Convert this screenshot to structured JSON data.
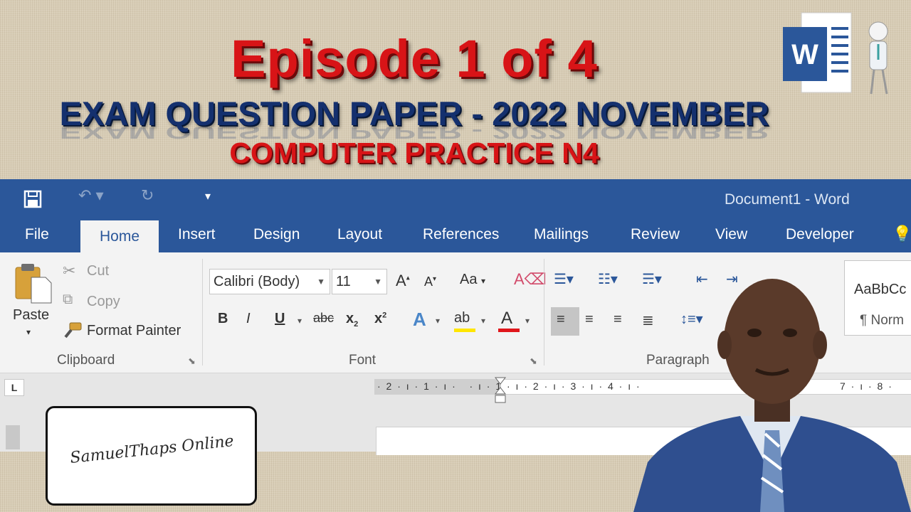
{
  "banner": {
    "episode": "Episode 1 of 4",
    "exam": "EXAM QUESTION PAPER - 2022 NOVEMBER",
    "course": "COMPUTER PRACTICE N4",
    "logo_letter": "W"
  },
  "window": {
    "title": "Document1 - Word",
    "tabs": [
      "File",
      "Home",
      "Insert",
      "Design",
      "Layout",
      "References",
      "Mailings",
      "Review",
      "View",
      "Developer"
    ],
    "active_tab": "Home",
    "accent_color": "#2b579a"
  },
  "clipboard": {
    "paste": "Paste",
    "cut": "Cut",
    "copy": "Copy",
    "format_painter": "Format Painter",
    "group_label": "Clipboard"
  },
  "font": {
    "family": "Calibri (Body)",
    "size": "11",
    "change_case": "Aa",
    "bold": "B",
    "italic": "I",
    "underline": "U",
    "strike": "abc",
    "subscript": "x",
    "subscript_mark": "2",
    "superscript": "x",
    "superscript_mark": "2",
    "group_label": "Font"
  },
  "paragraph": {
    "group_label": "Paragraph"
  },
  "styles": {
    "preview": "AaBbCc",
    "normal": "¶ Norm"
  },
  "ruler": {
    "text": "· 2 · ı · 1 · ı ·   · ı · 1 · ı · 2 · ı · 3 · ı · 4 · ı ·"
  },
  "ruler_right": "7 · ı · 8 ·",
  "signature": "SamuelThaps Online"
}
